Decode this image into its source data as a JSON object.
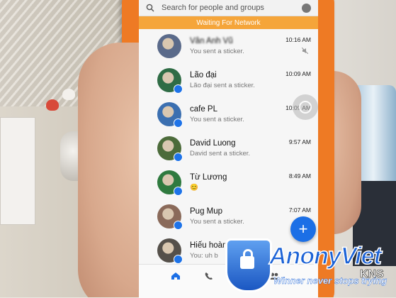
{
  "search": {
    "placeholder": "Search for people and groups"
  },
  "banner": {
    "text": "Waiting For Network"
  },
  "conversations": [
    {
      "name": "Vân Anh Vũ",
      "snippet": "You sent a sticker.",
      "time": "10:16 AM",
      "muted": true,
      "avatar_color": "#5a6a8a"
    },
    {
      "name": "Lão đại",
      "snippet": "Lão đại sent a sticker.",
      "time": "10:09 AM",
      "muted": false,
      "avatar_color": "#2f6c45"
    },
    {
      "name": "cafe PL",
      "snippet": "You sent a sticker.",
      "time": "10:09 AM",
      "muted": false,
      "avatar_color": "#3b6fb0"
    },
    {
      "name": "David Luong",
      "snippet": "David sent a sticker.",
      "time": "9:57 AM",
      "muted": false,
      "avatar_color": "#4c6b3a"
    },
    {
      "name": "Từ Lương",
      "snippet": "😊",
      "time": "8:49 AM",
      "muted": false,
      "avatar_color": "#2f7a3f"
    },
    {
      "name": "Pug Mup",
      "snippet": "You sent a sticker.",
      "time": "7:07 AM",
      "muted": false,
      "avatar_color": "#8a6a5a"
    },
    {
      "name": "Hiếu hoàn hảo",
      "snippet": "You: uh b",
      "time": "",
      "muted": false,
      "avatar_color": "#55504a"
    }
  ],
  "fab": {
    "label": "+"
  },
  "watermark": {
    "brand": "AnonyViet",
    "tagline": "Winner never stops trying",
    "corner": "KNS"
  },
  "colors": {
    "accent": "#1b6fe6",
    "network_banner": "#f5a53a",
    "phone_body": "#ee7a24"
  },
  "icons": [
    "search-icon",
    "account-icon",
    "messenger-badge-icon",
    "mute-icon",
    "home-icon",
    "phone-icon",
    "people-icon",
    "add-icon",
    "lock-icon"
  ]
}
